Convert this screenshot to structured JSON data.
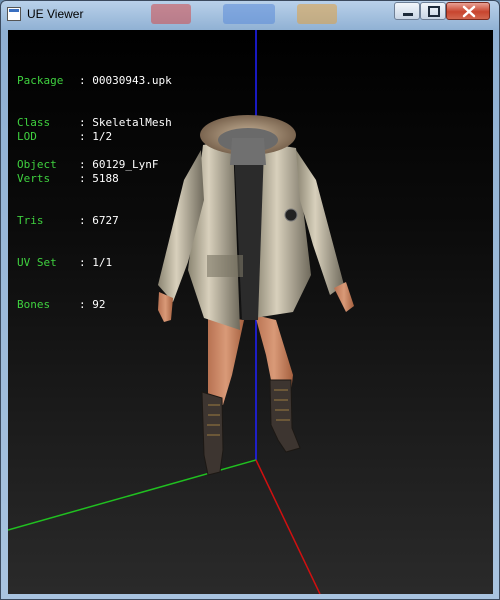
{
  "window": {
    "title": "UE Viewer"
  },
  "info_block_1": [
    {
      "label": "Package",
      "value": "00030943.upk"
    },
    {
      "label": "Class",
      "value": "SkeletalMesh"
    },
    {
      "label": "Object",
      "value": "60129_LynF"
    }
  ],
  "info_block_2": [
    {
      "label": "LOD",
      "value": "1/2"
    },
    {
      "label": "Verts",
      "value": "5188"
    },
    {
      "label": "Tris",
      "value": "6727"
    },
    {
      "label": "UV Set",
      "value": "1/1"
    },
    {
      "label": "Bones",
      "value": "92"
    }
  ],
  "colors": {
    "label_green": "#3fd13f",
    "axis_x": "#d01010",
    "axis_y": "#20c020",
    "axis_z": "#2020ff"
  },
  "icons": [
    "app-icon",
    "minimize-icon",
    "maximize-icon",
    "close-icon"
  ]
}
